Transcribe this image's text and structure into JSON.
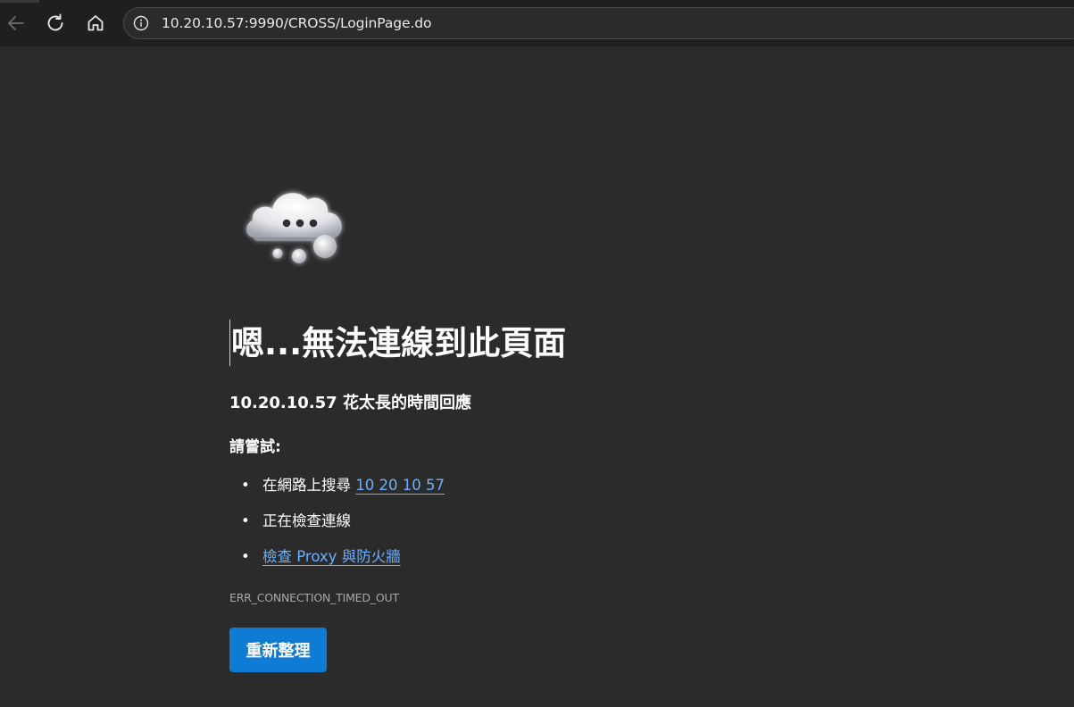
{
  "browser": {
    "url": "10.20.10.57:9990/CROSS/LoginPage.do"
  },
  "error_page": {
    "title": "嗯...無法連線到此頁面",
    "subtitle": "10.20.10.57 花太長的時間回應",
    "try_label": "請嘗試:",
    "suggestions": [
      {
        "prefix": "在網路上搜尋 ",
        "link": "10 20 10 57"
      },
      {
        "text": "正在檢查連線"
      },
      {
        "link": "檢查 Proxy 與防火牆"
      }
    ],
    "bullet": "•",
    "error_code": "ERR_CONNECTION_TIMED_OUT",
    "refresh_button": "重新整理"
  },
  "colors": {
    "background": "#2b2b2b",
    "toolbar": "#1f1f1f",
    "link": "#6ab0ff",
    "button": "#0f7bd4"
  },
  "icons": [
    "back-arrow-icon",
    "reload-icon",
    "home-icon",
    "info-icon",
    "cloud-thought-icon"
  ]
}
